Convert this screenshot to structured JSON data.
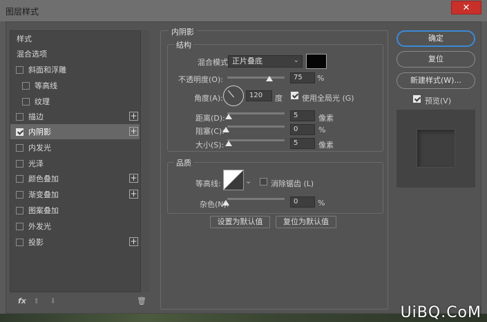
{
  "window": {
    "title": "图层样式",
    "close_glyph": "✕"
  },
  "left_list": {
    "items": [
      {
        "label": "样式",
        "checkbox": false,
        "checked": false,
        "plus": false,
        "indent": false,
        "selected": false
      },
      {
        "label": "混合选项",
        "checkbox": false,
        "checked": false,
        "plus": false,
        "indent": false,
        "selected": false
      },
      {
        "label": "斜面和浮雕",
        "checkbox": true,
        "checked": false,
        "plus": false,
        "indent": false,
        "selected": false
      },
      {
        "label": "等高线",
        "checkbox": true,
        "checked": false,
        "plus": false,
        "indent": true,
        "selected": false
      },
      {
        "label": "纹理",
        "checkbox": true,
        "checked": false,
        "plus": false,
        "indent": true,
        "selected": false
      },
      {
        "label": "描边",
        "checkbox": true,
        "checked": false,
        "plus": true,
        "indent": false,
        "selected": false
      },
      {
        "label": "内阴影",
        "checkbox": true,
        "checked": true,
        "plus": true,
        "indent": false,
        "selected": true
      },
      {
        "label": "内发光",
        "checkbox": true,
        "checked": false,
        "plus": false,
        "indent": false,
        "selected": false
      },
      {
        "label": "光泽",
        "checkbox": true,
        "checked": false,
        "plus": false,
        "indent": false,
        "selected": false
      },
      {
        "label": "颜色叠加",
        "checkbox": true,
        "checked": false,
        "plus": true,
        "indent": false,
        "selected": false
      },
      {
        "label": "渐变叠加",
        "checkbox": true,
        "checked": false,
        "plus": true,
        "indent": false,
        "selected": false
      },
      {
        "label": "图案叠加",
        "checkbox": true,
        "checked": false,
        "plus": false,
        "indent": false,
        "selected": false
      },
      {
        "label": "外发光",
        "checkbox": true,
        "checked": false,
        "plus": false,
        "indent": false,
        "selected": false
      },
      {
        "label": "投影",
        "checkbox": true,
        "checked": false,
        "plus": true,
        "indent": false,
        "selected": false
      }
    ],
    "footer": {
      "fx": "fx",
      "up_glyph": "⬆",
      "down_glyph": "⬇",
      "trash_glyph": "🗑"
    }
  },
  "inner_shadow": {
    "section_title": "内阴影",
    "structure_title": "结构",
    "blend_mode_label": "混合模式:",
    "blend_mode_value": "正片叠底",
    "shadow_color": "#050505",
    "opacity_label": "不透明度(O):",
    "opacity_value": "75",
    "opacity_fraction": 0.75,
    "angle_label": "角度(A):",
    "angle_value": "120",
    "angle_unit": "度",
    "global_light_label": "使用全局光 (G)",
    "global_light_checked": true,
    "distance_label": "距离(D):",
    "distance_value": "5",
    "choke_label": "阻塞(C):",
    "choke_value": "0",
    "size_label": "大小(S):",
    "size_value": "5",
    "pixels_unit": "像素",
    "percent_unit": "%",
    "quality_title": "品质",
    "contour_label": "等高线:",
    "antialias_label": "消除锯齿 (L)",
    "antialias_checked": false,
    "noise_label": "杂色(N):",
    "noise_value": "0",
    "make_default_label": "设置为默认值",
    "reset_default_label": "复位为默认值"
  },
  "right": {
    "ok_label": "确定",
    "reset_label": "复位",
    "new_style_label": "新建样式(W)...",
    "preview_label": "预览(V)",
    "preview_checked": true,
    "accent": "#3b8ad8"
  },
  "watermark": "UiBQ.CoM"
}
